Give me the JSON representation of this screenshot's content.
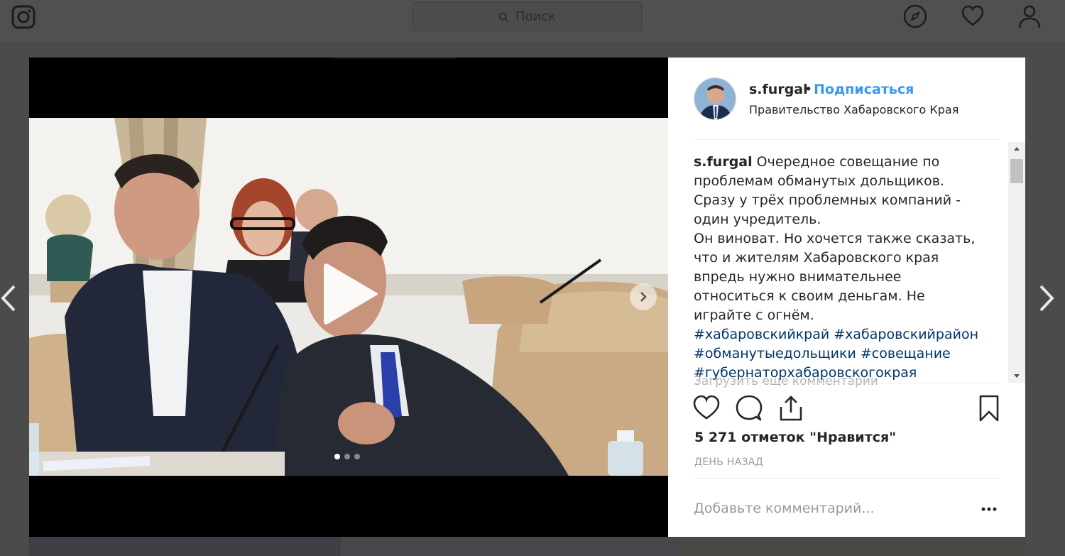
{
  "topbar": {
    "search_placeholder": "Поиск",
    "icons": [
      "instagram-icon",
      "search-icon",
      "explore-compass-icon",
      "heart-icon",
      "profile-icon"
    ]
  },
  "post": {
    "username": "s.furgal",
    "separator": "•",
    "follow_label": "Подписаться",
    "location": "Правительство Хабаровского Края",
    "caption_user": "s.furgal",
    "caption_text": " Очередное совещание по проблемам обманутых дольщиков. Сразу у трёх проблемных компаний - один учредитель.",
    "caption_text_2": "Он виноват. Но хочется также сказать, что и жителям Хабаровского края впредь нужно внимательнее относиться к своим деньгам. Не играйте с огнём.",
    "hashtags": "#хабаровскийкрай #хабаровскийрайон #обманутыедольщики #совещание #губернаторхабаровскогокрая #фургал",
    "load_more": "Загрузить еще комментарии",
    "likes": "5 271 отметок \"Нравится\"",
    "time_ago": "ДЕНЬ НАЗАД",
    "comment_placeholder": "Добавьте комментарий..."
  },
  "carousel": {
    "slide_count": 3,
    "active_slide": 1
  },
  "colors": {
    "accent": "#3897f0",
    "hashtag": "#003569",
    "overlay": "#4b4b4b"
  }
}
